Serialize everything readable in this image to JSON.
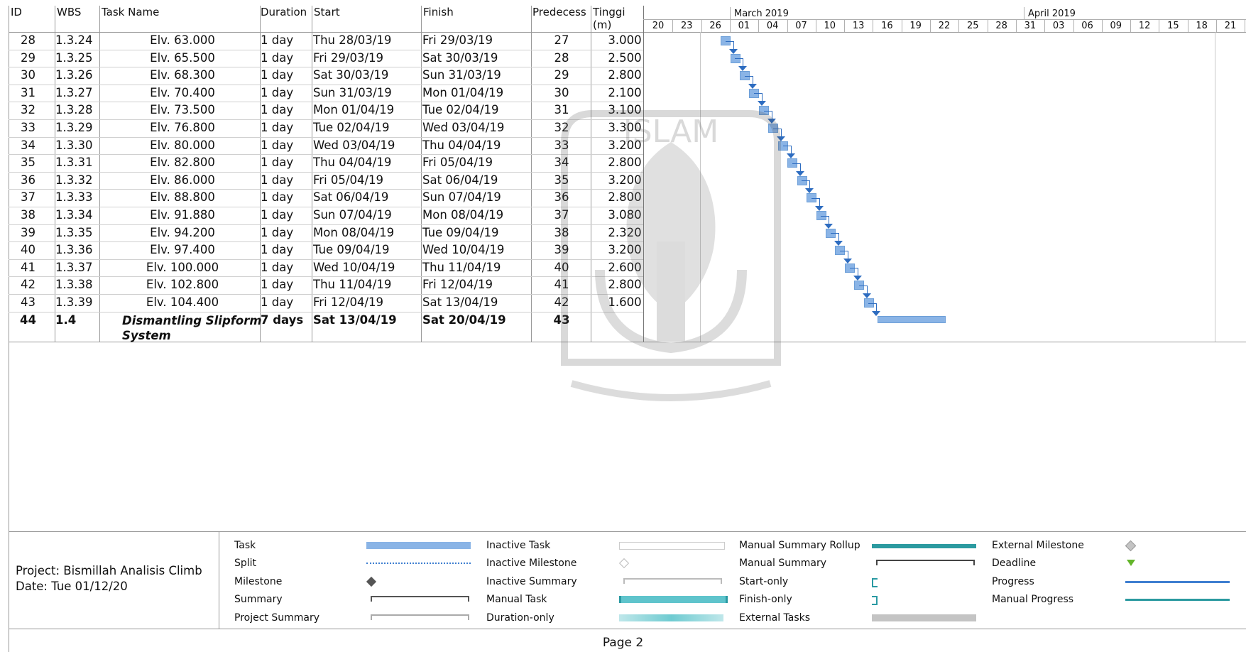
{
  "columns": {
    "id": "ID",
    "wbs": "WBS",
    "task_name": "Task Name",
    "duration": "Duration",
    "start": "Start",
    "finish": "Finish",
    "predecessors": "Predecess",
    "tinggi": "Tinggi\n(m)"
  },
  "timescale": {
    "months": [
      "March 2019",
      "April 2019"
    ],
    "days": [
      "20",
      "23",
      "26",
      "01",
      "04",
      "07",
      "10",
      "13",
      "16",
      "19",
      "22",
      "25",
      "28",
      "31",
      "03",
      "06",
      "09",
      "12",
      "15",
      "18",
      "21"
    ]
  },
  "tasks": [
    {
      "id": "28",
      "wbs": "1.3.24",
      "name": "Elv. 63.000",
      "duration": "1 day",
      "start": "Thu 28/03/19",
      "finish": "Fri 29/03/19",
      "pred": "27",
      "tinggi": "3.000"
    },
    {
      "id": "29",
      "wbs": "1.3.25",
      "name": "Elv. 65.500",
      "duration": "1 day",
      "start": "Fri 29/03/19",
      "finish": "Sat 30/03/19",
      "pred": "28",
      "tinggi": "2.500"
    },
    {
      "id": "30",
      "wbs": "1.3.26",
      "name": "Elv. 68.300",
      "duration": "1 day",
      "start": "Sat 30/03/19",
      "finish": "Sun 31/03/19",
      "pred": "29",
      "tinggi": "2.800"
    },
    {
      "id": "31",
      "wbs": "1.3.27",
      "name": "Elv. 70.400",
      "duration": "1 day",
      "start": "Sun 31/03/19",
      "finish": "Mon 01/04/19",
      "pred": "30",
      "tinggi": "2.100"
    },
    {
      "id": "32",
      "wbs": "1.3.28",
      "name": "Elv. 73.500",
      "duration": "1 day",
      "start": "Mon 01/04/19",
      "finish": "Tue 02/04/19",
      "pred": "31",
      "tinggi": "3.100"
    },
    {
      "id": "33",
      "wbs": "1.3.29",
      "name": "Elv. 76.800",
      "duration": "1 day",
      "start": "Tue 02/04/19",
      "finish": "Wed 03/04/19",
      "pred": "32",
      "tinggi": "3.300"
    },
    {
      "id": "34",
      "wbs": "1.3.30",
      "name": "Elv. 80.000",
      "duration": "1 day",
      "start": "Wed 03/04/19",
      "finish": "Thu 04/04/19",
      "pred": "33",
      "tinggi": "3.200"
    },
    {
      "id": "35",
      "wbs": "1.3.31",
      "name": "Elv. 82.800",
      "duration": "1 day",
      "start": "Thu 04/04/19",
      "finish": "Fri 05/04/19",
      "pred": "34",
      "tinggi": "2.800"
    },
    {
      "id": "36",
      "wbs": "1.3.32",
      "name": "Elv. 86.000",
      "duration": "1 day",
      "start": "Fri 05/04/19",
      "finish": "Sat 06/04/19",
      "pred": "35",
      "tinggi": "3.200"
    },
    {
      "id": "37",
      "wbs": "1.3.33",
      "name": "Elv. 88.800",
      "duration": "1 day",
      "start": "Sat 06/04/19",
      "finish": "Sun 07/04/19",
      "pred": "36",
      "tinggi": "2.800"
    },
    {
      "id": "38",
      "wbs": "1.3.34",
      "name": "Elv. 91.880",
      "duration": "1 day",
      "start": "Sun 07/04/19",
      "finish": "Mon 08/04/19",
      "pred": "37",
      "tinggi": "3.080"
    },
    {
      "id": "39",
      "wbs": "1.3.35",
      "name": "Elv. 94.200",
      "duration": "1 day",
      "start": "Mon 08/04/19",
      "finish": "Tue 09/04/19",
      "pred": "38",
      "tinggi": "2.320"
    },
    {
      "id": "40",
      "wbs": "1.3.36",
      "name": "Elv. 97.400",
      "duration": "1 day",
      "start": "Tue 09/04/19",
      "finish": "Wed 10/04/19",
      "pred": "39",
      "tinggi": "3.200"
    },
    {
      "id": "41",
      "wbs": "1.3.37",
      "name": "Elv. 100.000",
      "duration": "1 day",
      "start": "Wed 10/04/19",
      "finish": "Thu 11/04/19",
      "pred": "40",
      "tinggi": "2.600"
    },
    {
      "id": "42",
      "wbs": "1.3.38",
      "name": "Elv. 102.800",
      "duration": "1 day",
      "start": "Thu 11/04/19",
      "finish": "Fri 12/04/19",
      "pred": "41",
      "tinggi": "2.800"
    },
    {
      "id": "43",
      "wbs": "1.3.39",
      "name": "Elv. 104.400",
      "duration": "1 day",
      "start": "Fri 12/04/19",
      "finish": "Sat 13/04/19",
      "pred": "42",
      "tinggi": "1.600"
    },
    {
      "id": "44",
      "wbs": "1.4",
      "name": "Dismantling Slipform System",
      "duration": "7 days",
      "start": "Sat 13/04/19",
      "finish": "Sat 20/04/19",
      "pred": "43",
      "tinggi": "",
      "summary": true
    }
  ],
  "legend": {
    "project": "Project: Bismillah Analisis Climb",
    "date": "Date: Tue 01/12/20",
    "items": [
      {
        "label": "Task",
        "shape": "task"
      },
      {
        "label": "Split",
        "shape": "split"
      },
      {
        "label": "Milestone",
        "shape": "milestone"
      },
      {
        "label": "Summary",
        "shape": "summary"
      },
      {
        "label": "Project Summary",
        "shape": "project-summary"
      },
      {
        "label": "Inactive Task",
        "shape": "inactive-task"
      },
      {
        "label": "Inactive Milestone",
        "shape": "inactive-milestone"
      },
      {
        "label": "Inactive Summary",
        "shape": "inactive-summary"
      },
      {
        "label": "Manual Task",
        "shape": "manual-task"
      },
      {
        "label": "Duration-only",
        "shape": "duration-only"
      },
      {
        "label": "Manual Summary Rollup",
        "shape": "manual-summary-rollup"
      },
      {
        "label": "Manual Summary",
        "shape": "manual-summary"
      },
      {
        "label": "Start-only",
        "shape": "start-only"
      },
      {
        "label": "Finish-only",
        "shape": "finish-only"
      },
      {
        "label": "External Tasks",
        "shape": "external-tasks"
      },
      {
        "label": "External Milestone",
        "shape": "external-milestone"
      },
      {
        "label": "Deadline",
        "shape": "deadline"
      },
      {
        "label": "Progress",
        "shape": "progress"
      },
      {
        "label": "Manual Progress",
        "shape": "manual-progress"
      }
    ]
  },
  "footer": {
    "page": "Page 2"
  },
  "colors": {
    "task_bar": "#8ab4e6",
    "link": "#2d6cc0",
    "manual": "#5fc4cc",
    "grid": "#9a9a9a"
  }
}
